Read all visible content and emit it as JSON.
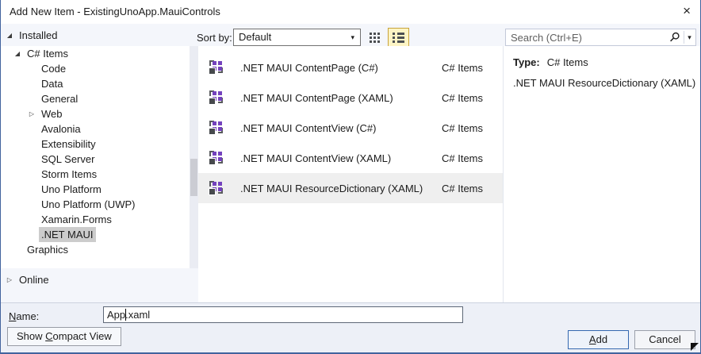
{
  "window": {
    "title": "Add New Item - ExistingUnoApp.MauiControls",
    "close_glyph": "×"
  },
  "glyphs": {
    "expanded": "◢",
    "collapsed": "▷",
    "dropdown_caret": "▾"
  },
  "left": {
    "installed": "Installed",
    "online": "Online",
    "items": [
      {
        "label": "C# Items",
        "level": 1,
        "state": "expanded",
        "selected": false
      },
      {
        "label": "Code",
        "level": 2,
        "state": "none",
        "selected": false
      },
      {
        "label": "Data",
        "level": 2,
        "state": "none",
        "selected": false
      },
      {
        "label": "General",
        "level": 2,
        "state": "none",
        "selected": false
      },
      {
        "label": "Web",
        "level": 2,
        "state": "collapsed",
        "selected": false
      },
      {
        "label": "Avalonia",
        "level": 2,
        "state": "none",
        "selected": false
      },
      {
        "label": "Extensibility",
        "level": 2,
        "state": "none",
        "selected": false
      },
      {
        "label": "SQL Server",
        "level": 2,
        "state": "none",
        "selected": false
      },
      {
        "label": "Storm Items",
        "level": 2,
        "state": "none",
        "selected": false
      },
      {
        "label": "Uno Platform",
        "level": 2,
        "state": "none",
        "selected": false
      },
      {
        "label": "Uno Platform (UWP)",
        "level": 2,
        "state": "none",
        "selected": false
      },
      {
        "label": "Xamarin.Forms",
        "level": 2,
        "state": "none",
        "selected": false
      },
      {
        "label": ".NET MAUI",
        "level": 2,
        "state": "none",
        "selected": true
      },
      {
        "label": "Graphics",
        "level": 1,
        "state": "none",
        "selected": false
      }
    ]
  },
  "toolbar": {
    "sort_label": "Sort by:",
    "sort_value": "Default",
    "search_placeholder": "Search (Ctrl+E)"
  },
  "list": {
    "rows": [
      {
        "icon": "maui-csharp",
        "label": ".NET MAUI ContentPage (C#)",
        "category": "C# Items",
        "selected": false
      },
      {
        "icon": "maui-xaml",
        "label": ".NET MAUI ContentPage (XAML)",
        "category": "C# Items",
        "selected": false
      },
      {
        "icon": "maui-csharp",
        "label": ".NET MAUI ContentView (C#)",
        "category": "C# Items",
        "selected": false
      },
      {
        "icon": "maui-xaml",
        "label": ".NET MAUI ContentView (XAML)",
        "category": "C# Items",
        "selected": false
      },
      {
        "icon": "maui-xaml",
        "label": ".NET MAUI ResourceDictionary (XAML)",
        "category": "C# Items",
        "selected": true
      }
    ]
  },
  "details": {
    "type_label": "Type:",
    "type_value": "C# Items",
    "description": ".NET MAUI ResourceDictionary (XAML)"
  },
  "footer": {
    "name_accel": "N",
    "name_rest": "ame:",
    "name_value": "App.xaml",
    "compact_pre": "Show ",
    "compact_accel": "C",
    "compact_rest": "ompact View",
    "add_accel": "A",
    "add_rest": "dd",
    "cancel": "Cancel"
  },
  "colors": {
    "window_border": "#42639e",
    "content_bg": "#f4f6fb",
    "tree_sel": "#cccccc",
    "list_sel": "#efefef",
    "toggle_bg": "#fdf4c4",
    "toggle_border": "#c8a33b",
    "icon_purple": "#7442bd",
    "add_border": "#3568b0"
  }
}
